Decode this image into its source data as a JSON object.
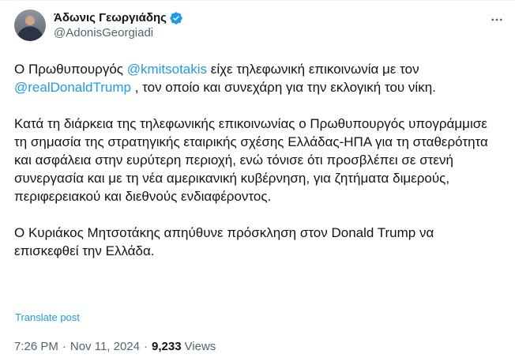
{
  "author": {
    "display_name": "Άδωνις Γεωργιάδης",
    "handle": "@AdonisGeorgiadi",
    "verified_icon": "verified-badge-icon",
    "avatar_icon": "avatar"
  },
  "tweet": {
    "p1_a": "Ο Πρωθυπουργός ",
    "p1_mention1": "@kmitsotakis",
    "p1_b": " είχε τηλεφωνική επικοινωνία με τον ",
    "p1_mention2": "@realDonaldTrump",
    "p1_c": " , τον οποίο και συνεχάρη για την εκλογική του νίκη.",
    "p2": "Κατά τη διάρκεια της τηλεφωνικής επικοινωνίας ο Πρωθυπουργός υπογράμμισε τη σημασία της στρατηγικής εταιρικής σχέσης Ελλάδας-ΗΠΑ για τη σταθερότητα και ασφάλεια στην ευρύτερη περιοχή, ενώ τόνισε ότι προσβλέπει σε στενή συνεργασία και με τη νέα αμερικανική κυβέρνηση, για ζητήματα διμερούς, περιφερειακού και διεθνούς ενδιαφέροντος.",
    "p3": "Ο Κυριάκος Μητσοτάκης απηύθυνε πρόσκληση στον Donald Trump να επισκεφθεί την Ελλάδα."
  },
  "translate_label": "Translate post",
  "meta": {
    "time": "7:26 PM",
    "separator": "·",
    "date": "Nov 11, 2024",
    "views_count": "9,233",
    "views_label": "Views"
  },
  "colors": {
    "accent": "#1d9bf0",
    "text": "#0f1419",
    "secondary": "#536471"
  }
}
